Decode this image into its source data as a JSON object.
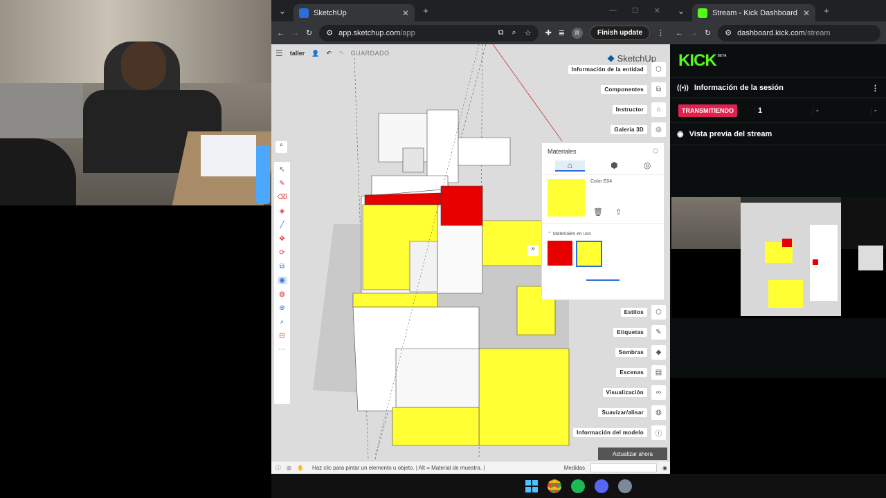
{
  "sketchup_window": {
    "tab_title": "SketchUp",
    "url_host": "app.sketchup.com",
    "url_path": "/app",
    "finish_update": "Finish update",
    "profile_initial": "R"
  },
  "sketchup": {
    "file_name": "taller",
    "save_status": "GUARDADO",
    "logo_text": "SketchUp",
    "right_panel": [
      {
        "label": "Información de la entidad",
        "icon": "info-entity-icon"
      },
      {
        "label": "Componentes",
        "icon": "components-icon"
      },
      {
        "label": "Instructor",
        "icon": "instructor-icon"
      },
      {
        "label": "Galería 3D",
        "icon": "gallery-icon"
      },
      {
        "label": "Estilos",
        "icon": "styles-icon"
      },
      {
        "label": "Etiquetas",
        "icon": "tags-icon"
      },
      {
        "label": "Sombras",
        "icon": "shadows-icon"
      },
      {
        "label": "Escenas",
        "icon": "scenes-icon"
      },
      {
        "label": "Visualización",
        "icon": "visualization-icon"
      },
      {
        "label": "Suavizar/alisar",
        "icon": "smooth-icon"
      },
      {
        "label": "Información del modelo",
        "icon": "model-info-icon"
      }
    ],
    "materials": {
      "title": "Materiales",
      "current_color_name": "Color E04",
      "current_color": "#ffff33",
      "in_use_label": "Materiales en uso",
      "in_use": [
        "#e60000",
        "#ffff33"
      ]
    },
    "update_button": "Actualizar ahora",
    "status_text": "Haz clic para pintar un elemento u objeto. | Alt = Material de muestra. |",
    "measures_label": "Medidas"
  },
  "kick_window": {
    "tab_title": "Stream - Kick Dashboard",
    "url_host": "dashboard.kick.com",
    "url_path": "/stream",
    "logo": "KICK",
    "logo_beta": "BETA",
    "session_title": "Información de la sesión",
    "live_badge": "TRANSMITIENDO",
    "viewers": "1",
    "stat2": "-",
    "stat3": "-",
    "preview_title": "Vista previa del stream"
  },
  "colors": {
    "kick_green": "#53fc18",
    "live_red": "#e0234e",
    "model_yellow": "#ffff33",
    "model_red": "#e60000"
  }
}
